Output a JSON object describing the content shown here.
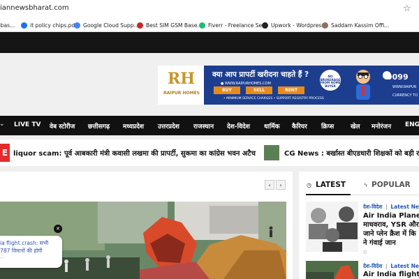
{
  "browser": {
    "url": "iannewsbharat.com",
    "bookmarks": [
      {
        "label": "ebas...",
        "icon": "bookmark-icon",
        "color": "#bbbbbb"
      },
      {
        "label": "it policy chips.pdf",
        "icon": "pdf-icon",
        "color": "#1a73e8"
      },
      {
        "label": "Google Cloud Supp...",
        "icon": "google-icon",
        "color": "#4285f4"
      },
      {
        "label": "Best SIM GSM Base...",
        "icon": "site-icon",
        "color": "#c62828"
      },
      {
        "label": "Fiverr - Freelance Se...",
        "icon": "fiverr-icon",
        "color": "#1dbf73"
      },
      {
        "label": "Upwork - Wordpress",
        "icon": "upwork-icon",
        "color": "#222222"
      },
      {
        "label": "Saddam Kassim Offi...",
        "icon": "person-icon",
        "color": "#8d6e63"
      }
    ]
  },
  "ad": {
    "logo_text": "RH",
    "brand": "RAIPUR HOMES",
    "headline": "क्या आप प्रापर्टी खरीदना चाहते हैं ?",
    "site": "● WWW.RAIPURHOMES.COM",
    "buttons": [
      "BUY",
      "SELL",
      "RENT"
    ],
    "tagline": "• MINIMUM SERVICE CHARGES • SUPPORT REGISTRY PROCESS",
    "stamp": "NO BROKERAGE FROM HOME BUYER",
    "phone": "9099",
    "site2": "WWW.RAIPUR",
    "currency": "CURRENCY TO"
  },
  "nav": {
    "items": [
      "LIVE TV",
      "वेब स्टोरीज",
      "छत्तीसगढ़",
      "मध्यप्रदेश",
      "उत्तरप्रदेश",
      "राजस्थान",
      "देश-विदेश",
      "धार्मिक",
      "कैरियर",
      "क्रिप्स",
      "खेल",
      "मनोरंजन",
      "ENGL"
    ]
  },
  "ticker": {
    "item1": "liquor scam: पूर्व आबकारी मंत्री कवासी लखमा की प्रापर्टी, सुकमा का कांग्रेस भवन अटैच",
    "item2": "CG News : बर्खास्त बीएडधारी शिक्षकों को बड़ी राह"
  },
  "main": {
    "popup_line1": "ia flight crash: सभी",
    "popup_line2": "787 विमानों की होगी",
    "popup_dots": "...",
    "close_label": "✕"
  },
  "sidebar": {
    "tab_latest": "LATEST",
    "tab_popular": "POPULAR",
    "item1": {
      "category": "देश-विदेश",
      "badge": "Latest News",
      "title_lines": [
        "Air India Plane Cr",
        "माधवराव, YSR और",
        "जाने प्लेन क्रैश में कि",
        "ने गंवाई जान"
      ]
    },
    "item2": {
      "category": "देश-विदेश",
      "badge": "Latest News",
      "title": "Air India flight cra"
    }
  },
  "colors": {
    "accent_red": "#e32b2b",
    "nav_bg": "#111111",
    "link_blue": "#2257b8",
    "ad_blue": "#1d3e8f",
    "ad_orange": "#e88b1a"
  }
}
